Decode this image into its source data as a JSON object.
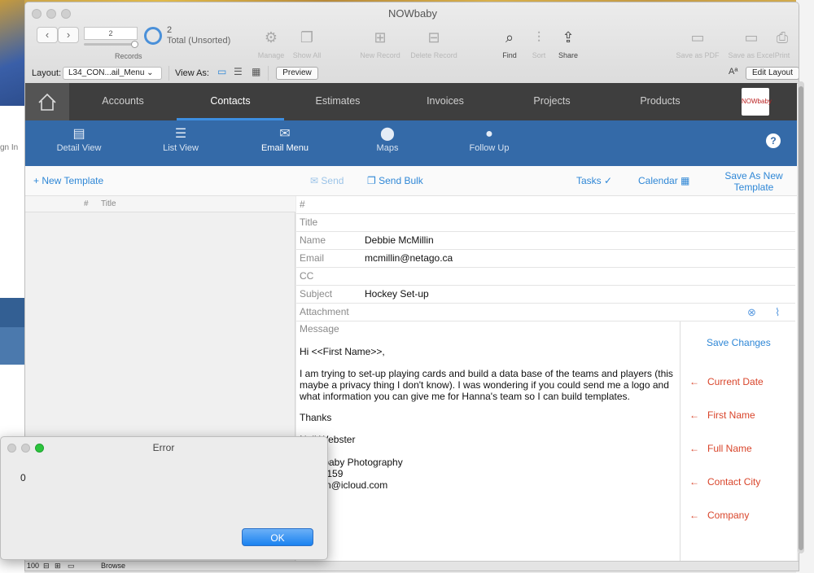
{
  "window": {
    "title": "NOWbaby"
  },
  "toolbar": {
    "record_number": "2",
    "records_label": "Records",
    "total_count": "2",
    "total_label": "Total (Unsorted)",
    "manage": "Manage",
    "show_all": "Show All",
    "new_record": "New Record",
    "delete_record": "Delete Record",
    "find": "Find",
    "sort": "Sort",
    "share": "Share",
    "save_pdf": "Save as PDF",
    "save_excel": "Save as Excel",
    "print": "Print"
  },
  "layoutbar": {
    "layout_label": "Layout:",
    "layout_value": "L34_CON...ail_Menu",
    "view_as_label": "View As:",
    "preview": "Preview",
    "edit_layout": "Edit Layout"
  },
  "nav": {
    "tabs": [
      "Accounts",
      "Contacts",
      "Estimates",
      "Invoices",
      "Projects",
      "Products"
    ],
    "active": "Contacts",
    "logo_text": "NOWbaby"
  },
  "subnav": {
    "items": [
      "Detail View",
      "List View",
      "Email Menu",
      "Maps",
      "Follow Up"
    ],
    "active": "Email Menu",
    "help": "?"
  },
  "actions": {
    "new_template": "New Template",
    "send": "Send",
    "send_bulk": "Send Bulk",
    "tasks": "Tasks",
    "calendar": "Calendar",
    "save_as_new_1": "Save As New",
    "save_as_new_2": "Template"
  },
  "list": {
    "col_num": "#",
    "col_title": "Title"
  },
  "form": {
    "num_label": "#",
    "title_label": "Title",
    "name_label": "Name",
    "name_value": "Debbie  McMillin",
    "email_label": "Email",
    "email_value": "mcmillin@netago.ca",
    "cc_label": "CC",
    "subject_label": "Subject",
    "subject_value": "Hockey Set-up",
    "attachment_label": "Attachment",
    "message_label": "Message",
    "message_lines": [
      "Hi <<First Name>>,",
      "I am trying to set-up playing cards and build a data base  of the teams and players (this maybe a privacy thing I don't know). I was wondering if you could send me a logo and what information you can give me for Hanna's team so I can build templates.",
      "Thanks",
      "Neil Webster",
      "NOWbaby Photography",
      "...29 9159",
      "...owen@icloud.com"
    ]
  },
  "side": {
    "save_changes": "Save Changes",
    "merge_fields": [
      "Current Date",
      "First Name",
      "Full Name",
      "Contact City",
      "Company"
    ]
  },
  "status": {
    "zoom": "100",
    "mode": "Browse"
  },
  "dialog": {
    "title": "Error",
    "message": "0",
    "ok": "OK"
  },
  "background": {
    "left_text": "gn In"
  },
  "colors": {
    "accent": "#2f87d6",
    "nav_dark": "#3e3e3e",
    "subnav_blue": "#346aa8",
    "merge_red": "#d9452b"
  }
}
